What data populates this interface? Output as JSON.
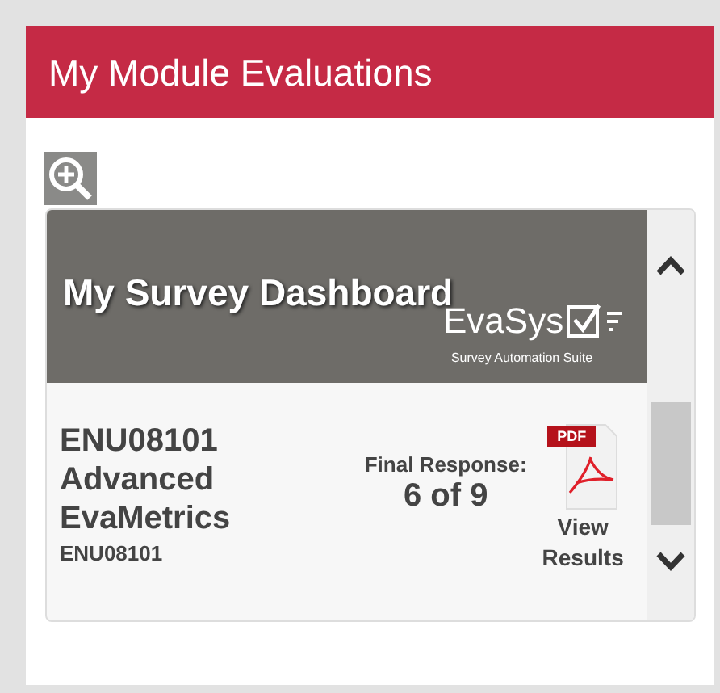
{
  "header": {
    "title": "My Module Evaluations"
  },
  "dashboard": {
    "title": "My Survey Dashboard",
    "brand": "EvaSys",
    "tagline": "Survey Automation Suite"
  },
  "modules": [
    {
      "code": "ENU08101",
      "name": "Advanced EvaMetrics",
      "subcode": "ENU08101",
      "status_label": "Final Response:",
      "responses": "6 of 9",
      "file_badge": "PDF",
      "link": "View Results"
    }
  ]
}
